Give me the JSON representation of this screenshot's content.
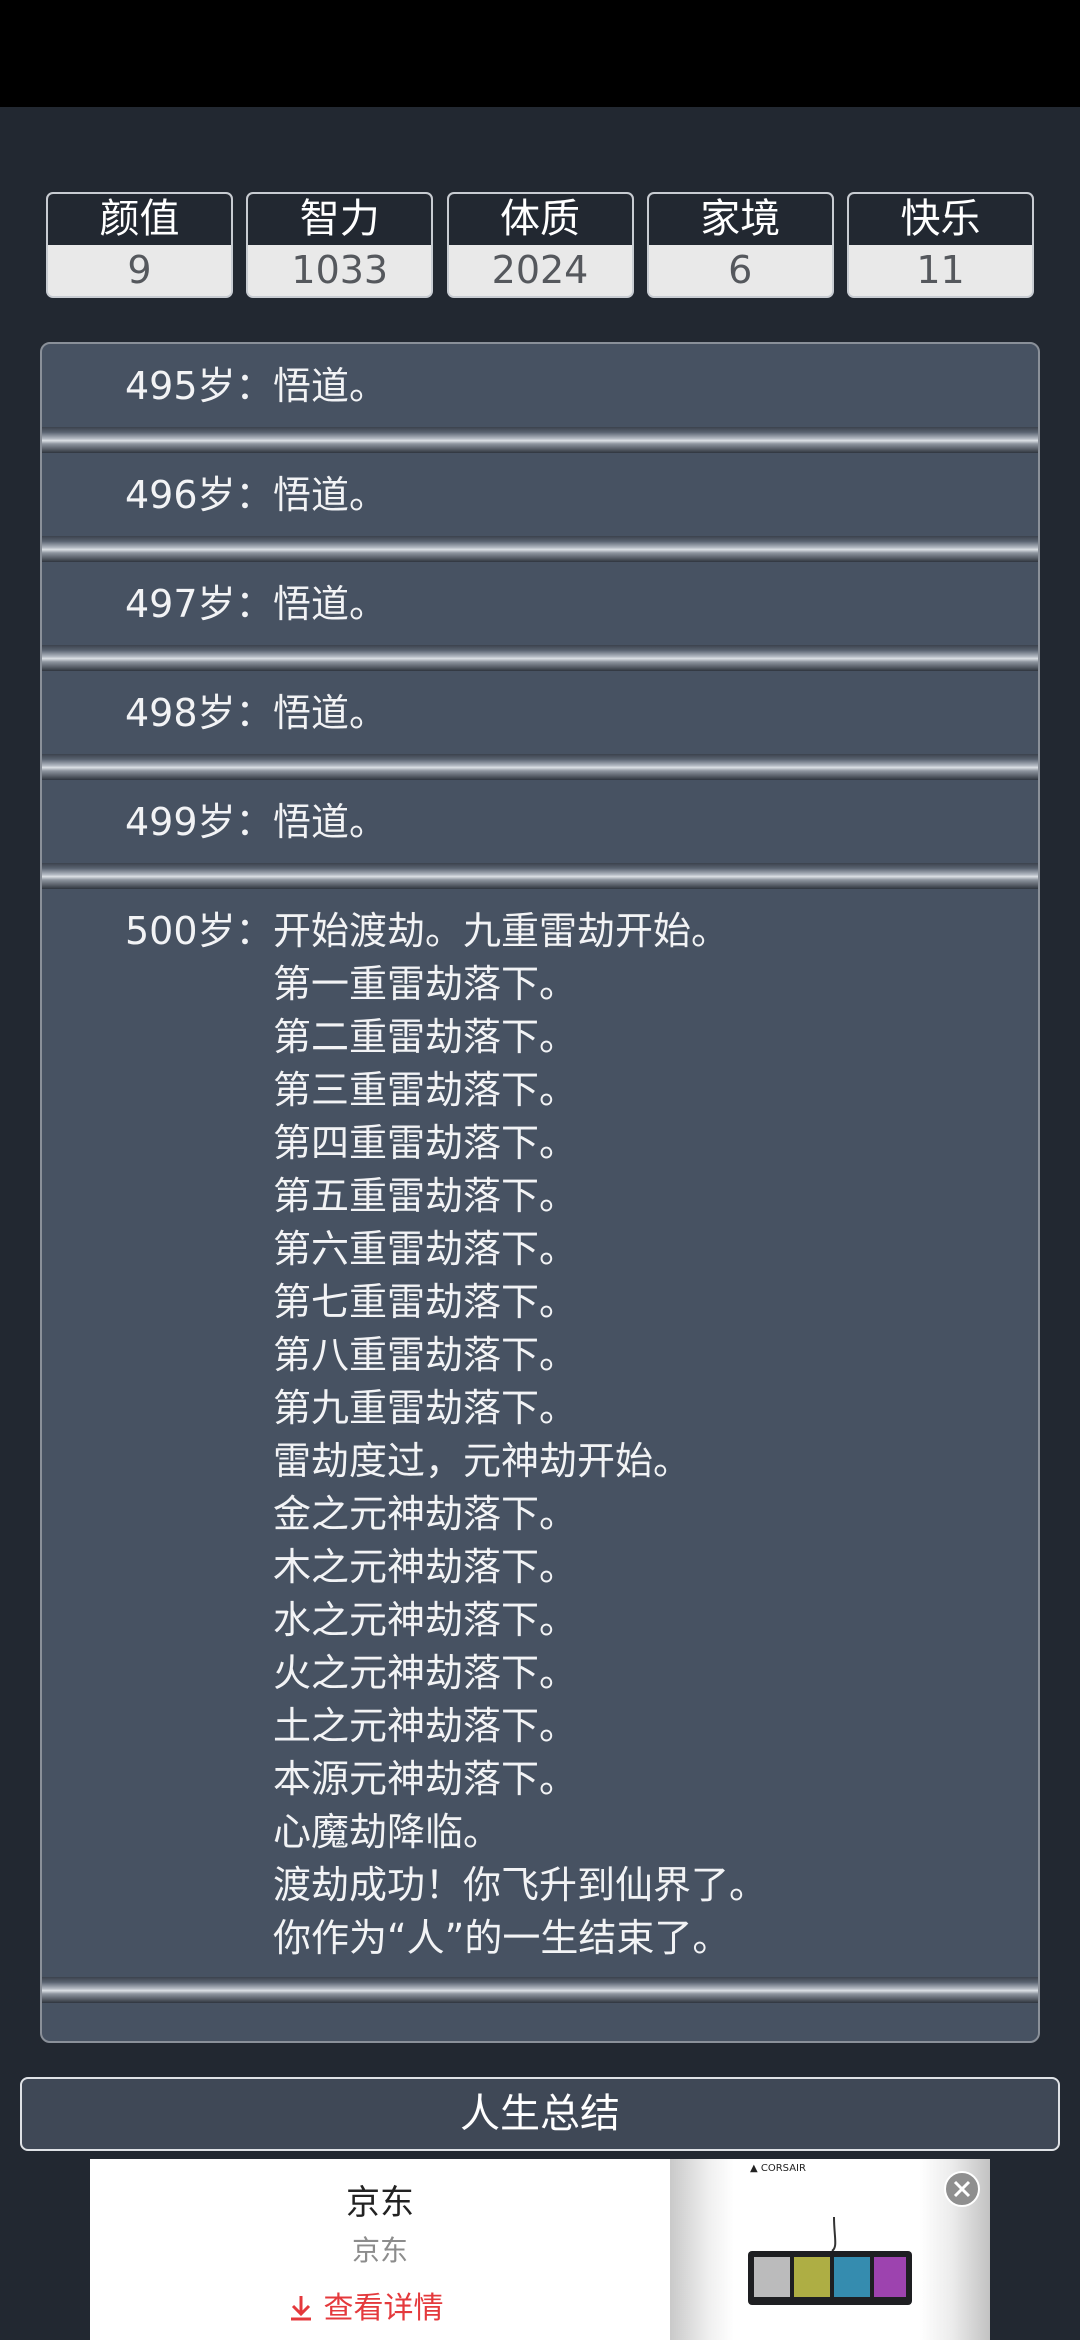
{
  "stats": [
    {
      "label": "颜值",
      "value": "9"
    },
    {
      "label": "智力",
      "value": "1033"
    },
    {
      "label": "体质",
      "value": "2024"
    },
    {
      "label": "家境",
      "value": "6"
    },
    {
      "label": "快乐",
      "value": "11"
    }
  ],
  "timeline": [
    {
      "age": "495岁：",
      "lines": [
        "悟道。"
      ]
    },
    {
      "age": "496岁：",
      "lines": [
        "悟道。"
      ]
    },
    {
      "age": "497岁：",
      "lines": [
        "悟道。"
      ]
    },
    {
      "age": "498岁：",
      "lines": [
        "悟道。"
      ]
    },
    {
      "age": "499岁：",
      "lines": [
        "悟道。"
      ]
    },
    {
      "age": "500岁：",
      "lines": [
        "开始渡劫。九重雷劫开始。",
        "第一重雷劫落下。",
        "第二重雷劫落下。",
        "第三重雷劫落下。",
        "第四重雷劫落下。",
        "第五重雷劫落下。",
        "第六重雷劫落下。",
        "第七重雷劫落下。",
        "第八重雷劫落下。",
        "第九重雷劫落下。",
        "雷劫度过，元神劫开始。",
        "金之元神劫落下。",
        "木之元神劫落下。",
        "水之元神劫落下。",
        "火之元神劫落下。",
        "土之元神劫落下。",
        "本源元神劫落下。",
        "心魔劫降临。",
        "渡劫成功！你飞升到仙界了。",
        "你作为“人”的一生结束了。"
      ]
    }
  ],
  "summary_button": "人生总结",
  "ad": {
    "title": "京东",
    "subtitle": "京东",
    "link": "查看详情",
    "link_icon": "download-arrow-icon",
    "accent": "#e4393c"
  }
}
